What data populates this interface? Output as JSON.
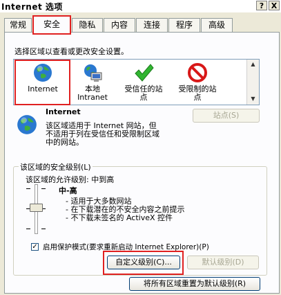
{
  "window": {
    "title": "Internet 选项",
    "help_glyph": "?",
    "close_glyph": "X"
  },
  "tabs": [
    {
      "label": "常规"
    },
    {
      "label": "安全"
    },
    {
      "label": "隐私"
    },
    {
      "label": "内容"
    },
    {
      "label": "连接"
    },
    {
      "label": "程序"
    },
    {
      "label": "高级"
    }
  ],
  "active_tab": "安全",
  "zones_prompt": "选择区域以查看或更改安全设置。",
  "zones": [
    {
      "label": "Internet",
      "icon": "globe-icon"
    },
    {
      "label": "本地\nIntranet",
      "icon": "intranet-icon"
    },
    {
      "label": "受信任的站\n点",
      "icon": "trusted-check-icon"
    },
    {
      "label": "受限制的站\n点",
      "icon": "restricted-icon"
    }
  ],
  "zone_detail": {
    "name": "Internet",
    "description": "该区域适用于 Internet 网站，但\n不适用于列在受信任和受限制区域\n中的网站。",
    "sites_button": "站点(S)"
  },
  "security_level": {
    "group_label": "该区域的安全级别(L)",
    "allowed_levels": "该区域的允许级别: 中到高",
    "level_name": "中-高",
    "bullets": [
      "- 适用于大多数网站",
      "- 在下载潜在的不安全内容之前提示",
      "- 不下载未签名的 ActiveX 控件"
    ],
    "slider_level": 0.5,
    "protected_mode_label": "启用保护模式(要求重新启动 Internet Explorer)(P)",
    "protected_mode_checked": true,
    "custom_level_button": "自定义级别(C)...",
    "default_level_button": "默认级别(D)"
  },
  "reset_all_button": "将所有区域重置为默认级别(R)",
  "colors": {
    "highlight_box": "#e02020",
    "dialog_bg": "#ece9d8"
  }
}
